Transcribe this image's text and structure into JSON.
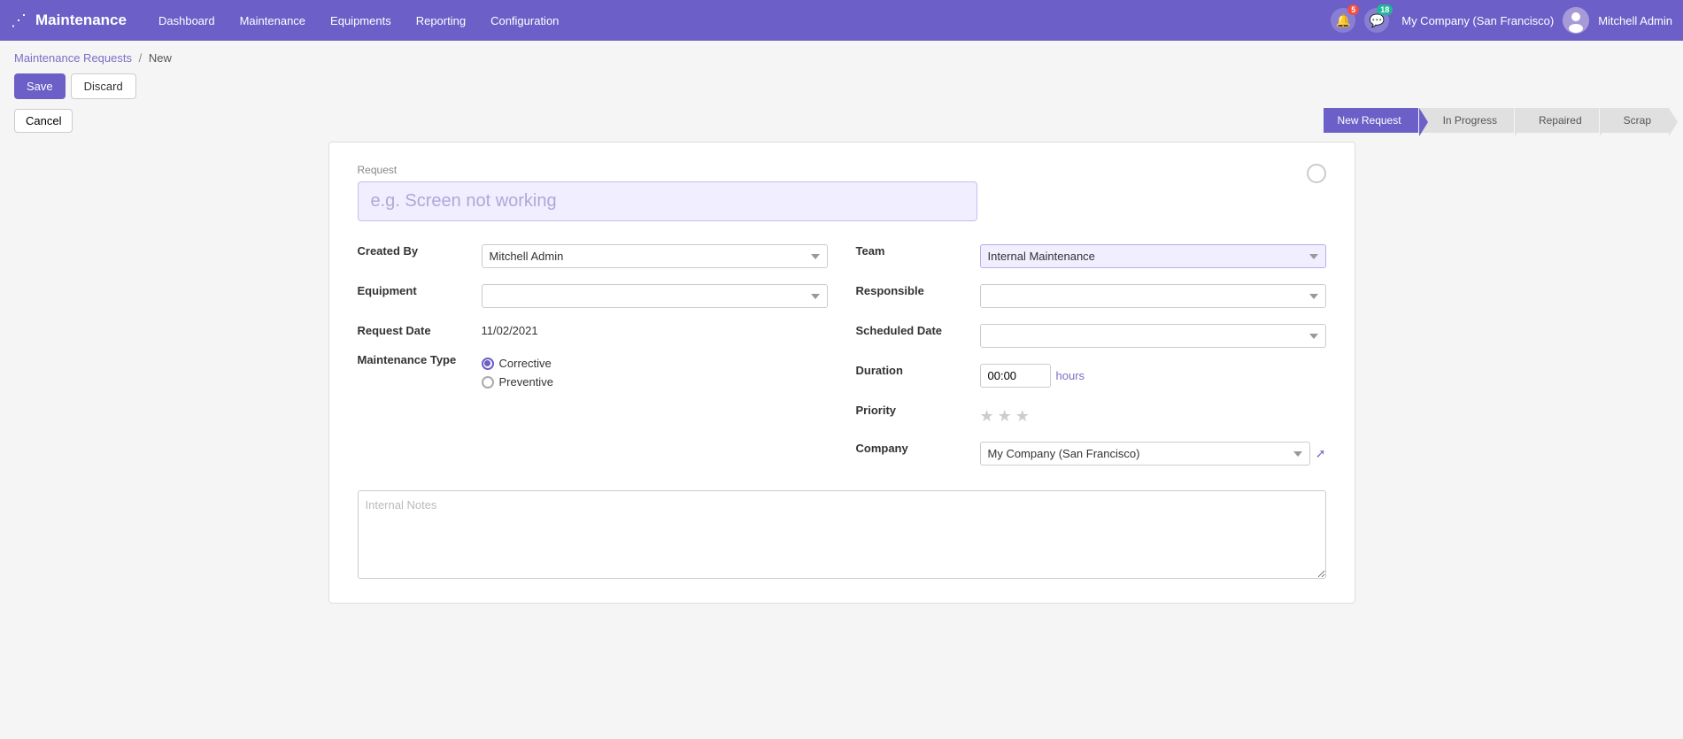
{
  "app": {
    "brand": "Maintenance",
    "grid_icon": "⊞"
  },
  "topnav": {
    "menu_items": [
      "Dashboard",
      "Maintenance",
      "Equipments",
      "Reporting",
      "Configuration"
    ],
    "notification_count": "5",
    "chat_count": "18",
    "company": "My Company (San Francisco)",
    "username": "Mitchell Admin"
  },
  "breadcrumb": {
    "parent": "Maintenance Requests",
    "separator": "/",
    "current": "New"
  },
  "action_bar": {
    "save_label": "Save",
    "discard_label": "Discard"
  },
  "status_bar": {
    "cancel_label": "Cancel",
    "pipeline": [
      "New Request",
      "In Progress",
      "Repaired",
      "Scrap"
    ]
  },
  "form": {
    "request_section_label": "Request",
    "request_placeholder": "e.g. Screen not working",
    "fields": {
      "created_by_label": "Created By",
      "created_by_value": "Mitchell Admin",
      "equipment_label": "Equipment",
      "equipment_placeholder": "",
      "request_date_label": "Request Date",
      "request_date_value": "11/02/2021",
      "maintenance_type_label": "Maintenance Type",
      "corrective_label": "Corrective",
      "preventive_label": "Preventive",
      "team_label": "Team",
      "team_value": "Internal Maintenance",
      "responsible_label": "Responsible",
      "responsible_value": "",
      "scheduled_date_label": "Scheduled Date",
      "scheduled_date_value": "",
      "duration_label": "Duration",
      "duration_value": "00:00",
      "duration_unit": "hours",
      "priority_label": "Priority",
      "company_label": "Company",
      "company_value": "My Company (San Francisco)"
    },
    "notes_placeholder": "Internal Notes"
  }
}
